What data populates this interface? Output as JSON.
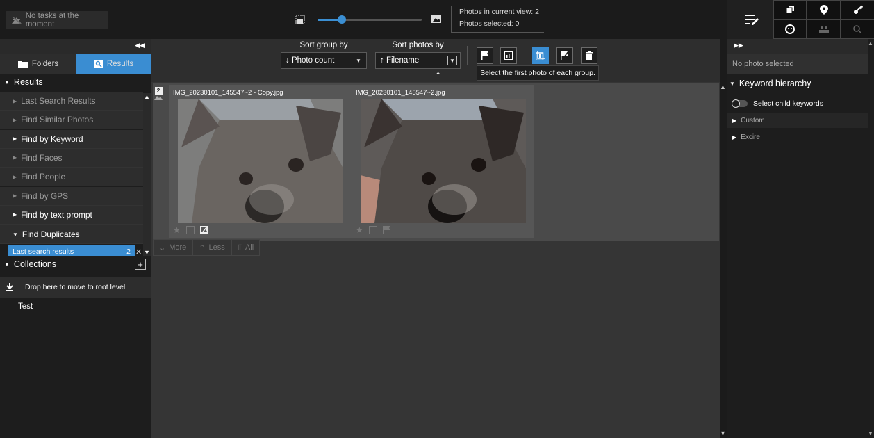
{
  "task_status": "No tasks at the moment",
  "stats": {
    "in_view": "Photos in current view: 2",
    "selected": "Photos selected: 0"
  },
  "zoom": {
    "level_fraction": 0.23
  },
  "left": {
    "tabs": [
      "Folders",
      "Results"
    ],
    "results_header": "Results",
    "items": [
      {
        "label": "Last Search Results",
        "bright": false
      },
      {
        "label": "Find Similar Photos",
        "bright": false
      },
      {
        "label": "Find by Keyword",
        "bright": true
      },
      {
        "label": "Find Faces",
        "bright": false
      },
      {
        "label": "Find People",
        "bright": false
      },
      {
        "label": "Find by GPS",
        "bright": false
      },
      {
        "label": "Find by text prompt",
        "bright": true
      }
    ],
    "find_duplicates": "Find Duplicates",
    "last_search": {
      "label": "Last search results",
      "count": "2"
    },
    "collections_header": "Collections",
    "drop_label": "Drop here to move to root level",
    "collections": [
      "Test"
    ]
  },
  "toolbar": {
    "sort_group_label": "Sort group by",
    "sort_group_value": "↓ Photo count",
    "sort_photos_label": "Sort photos by",
    "sort_photos_value": "↑ Filename",
    "tooltip": "Select the first photo of each group."
  },
  "group": {
    "count": "2",
    "photos": [
      {
        "filename": "IMG_20230101_145547~2 - Copy.jpg"
      },
      {
        "filename": "IMG_20230101_145547~2.jpg"
      }
    ]
  },
  "more_less": {
    "more": "More",
    "less": "Less",
    "all": "All"
  },
  "right": {
    "no_selection": "No photo selected",
    "keyword_hierarchy": "Keyword hierarchy",
    "select_child": "Select child keywords",
    "keywords": [
      "Custom",
      "Excire"
    ]
  }
}
